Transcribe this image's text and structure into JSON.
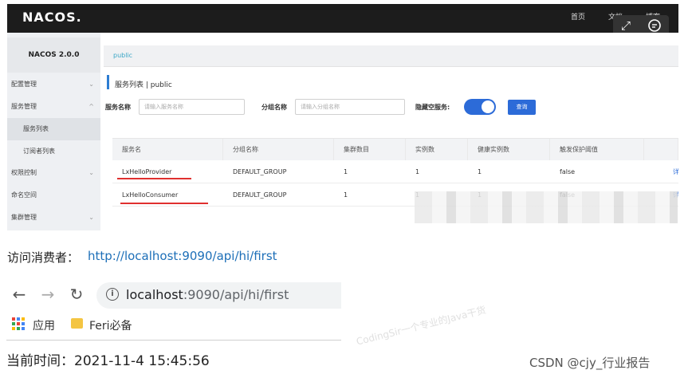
{
  "nacos": {
    "logo": "NACOS.",
    "topnav": [
      "首页",
      "文档",
      "博客"
    ],
    "version": "NACOS 2.0.0",
    "sidebar": [
      {
        "label": "配置管理",
        "chev": "⌄"
      },
      {
        "label": "服务管理",
        "chev": "^"
      },
      {
        "label": "服务列表",
        "chev": ""
      },
      {
        "label": "订阅者列表",
        "chev": ""
      },
      {
        "label": "权限控制",
        "chev": "⌄"
      },
      {
        "label": "命名空间",
        "chev": ""
      },
      {
        "label": "集群管理",
        "chev": "⌄"
      }
    ],
    "breadcrumb": "public",
    "page_title": "服务列表 | public",
    "filters": {
      "service_label": "服务名称",
      "service_placeholder": "请输入服务名称",
      "group_label": "分组名称",
      "group_placeholder": "请输入分组名称",
      "hide_empty_label": "隐藏空服务:",
      "query_button": "查询"
    },
    "table": {
      "headers": [
        "服务名",
        "分组名称",
        "集群数目",
        "实例数",
        "健康实例数",
        "触发保护阈值"
      ],
      "rows": [
        [
          "LxHelloProvider",
          "DEFAULT_GROUP",
          "1",
          "1",
          "1",
          "false",
          "详"
        ],
        [
          "LxHelloConsumer",
          "DEFAULT_GROUP",
          "1",
          "1",
          "1",
          "false",
          "详"
        ]
      ]
    }
  },
  "visit": {
    "label": "访问消费者：",
    "link": "http://localhost:9090/api/hi/first"
  },
  "browser": {
    "url_host": "localhost",
    "url_path": ":9090/api/hi/first",
    "bookmarks": [
      "应用",
      "Feri必备"
    ]
  },
  "result": {
    "time_text": "当前时间：2021-11-4 15:45:56"
  },
  "watermarks": {
    "center": "CodingSir一个专业的Java干货",
    "csdn": "CSDN @cjy_行业报告"
  }
}
